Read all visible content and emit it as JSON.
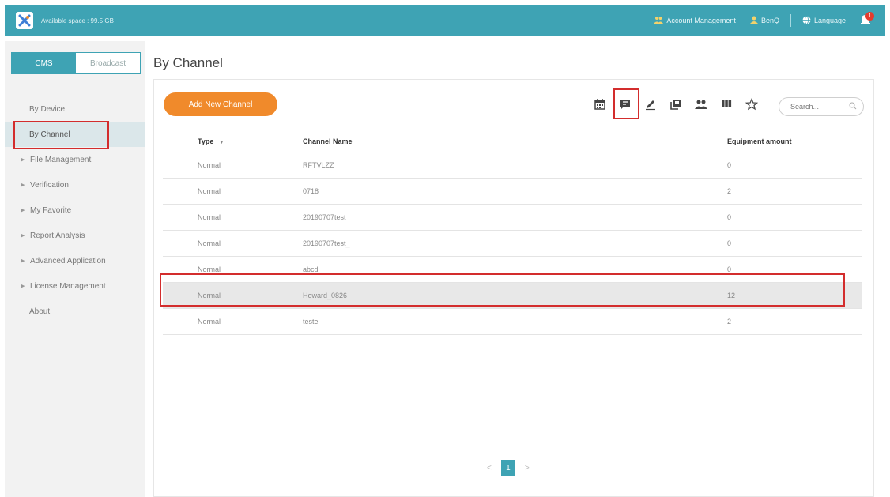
{
  "header": {
    "available_space": "Available space : 99.5 GB",
    "account_management": "Account Management",
    "user": "BenQ",
    "language": "Language",
    "notification_count": "1",
    "accent_color": "#3ea3b4"
  },
  "sidebar": {
    "mode_cms": "CMS",
    "mode_broadcast": "Broadcast",
    "items": [
      {
        "label": "By Device"
      },
      {
        "label": "By Channel"
      },
      {
        "label": "File Management"
      },
      {
        "label": "Verification"
      },
      {
        "label": "My Favorite"
      },
      {
        "label": "Report Analysis"
      },
      {
        "label": "Advanced Application"
      },
      {
        "label": "License Management"
      },
      {
        "label": "About"
      }
    ]
  },
  "main": {
    "title": "By Channel",
    "add_button": "Add New Channel",
    "search_placeholder": "Search...",
    "toolbar_icons": [
      "calendar-icon",
      "message-icon",
      "edit-icon",
      "copy-icon",
      "group-icon",
      "grid-icon",
      "star-icon"
    ],
    "table": {
      "headers": [
        "Type",
        "Channel Name",
        "Equipment amount"
      ],
      "sort_indicator": "▼",
      "rows": [
        {
          "type": "Normal",
          "name": "RFTVLZZ",
          "amount": "0"
        },
        {
          "type": "Normal",
          "name": "0718",
          "amount": "2"
        },
        {
          "type": "Normal",
          "name": "20190707test",
          "amount": "0"
        },
        {
          "type": "Normal",
          "name": "20190707test_",
          "amount": "0"
        },
        {
          "type": "Normal",
          "name": "abcd",
          "amount": "0"
        },
        {
          "type": "Normal",
          "name": "Howard_0826",
          "amount": "12"
        },
        {
          "type": "Normal",
          "name": "teste",
          "amount": "2"
        }
      ]
    },
    "pagination": {
      "prev": "<",
      "current": "1",
      "next": ">"
    }
  }
}
